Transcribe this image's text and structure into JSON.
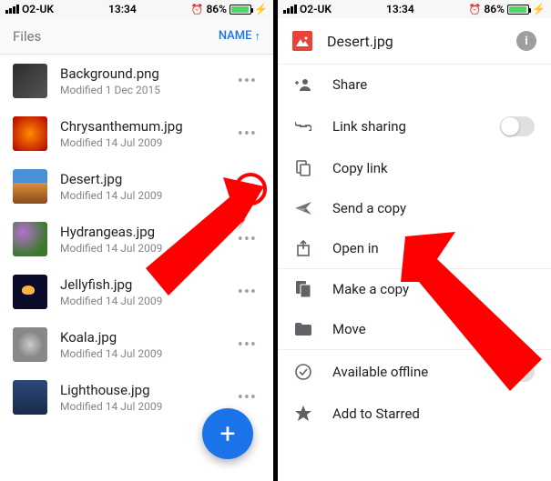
{
  "status": {
    "carrier": "O2-UK",
    "time": "13:34",
    "battery_pct": "86%",
    "charging_glyph": "⚡"
  },
  "left_panel": {
    "header": {
      "files_label": "Files",
      "sort_label": "NAME"
    },
    "files": [
      {
        "name": "Background.png",
        "modified": "Modified 1 Dec 2015"
      },
      {
        "name": "Chrysanthemum.jpg",
        "modified": "Modified 14 Jul 2009"
      },
      {
        "name": "Desert.jpg",
        "modified": "Modified 14 Jul 2009"
      },
      {
        "name": "Hydrangeas.jpg",
        "modified": "Modified 14 Jul 2009"
      },
      {
        "name": "Jellyfish.jpg",
        "modified": "Modified 14 Jul 2009"
      },
      {
        "name": "Koala.jpg",
        "modified": "Modified 14 Jul 2009"
      },
      {
        "name": "Lighthouse.jpg",
        "modified": "Modified 14 Jul 2009"
      }
    ],
    "fab_glyph": "+"
  },
  "right_panel": {
    "title": "Desert.jpg",
    "info_glyph": "i",
    "actions": {
      "share": "Share",
      "link_sharing": "Link sharing",
      "copy_link": "Copy link",
      "send_copy": "Send a copy",
      "open_in": "Open in",
      "make_copy": "Make a copy",
      "move": "Move",
      "available_offline": "Available offline",
      "add_starred": "Add to Starred"
    }
  }
}
